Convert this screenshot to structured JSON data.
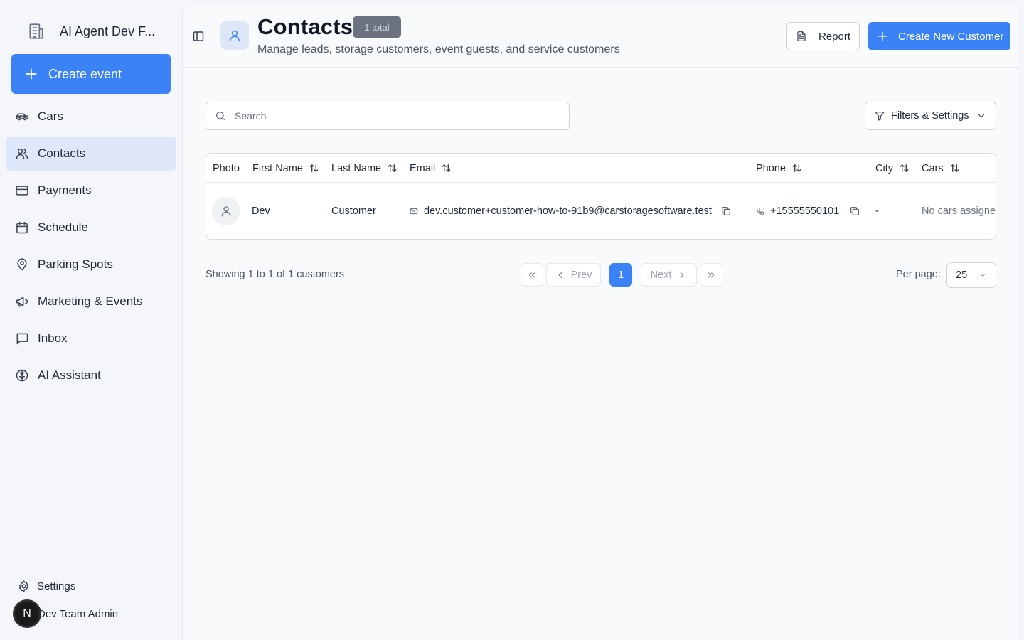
{
  "sidebar": {
    "org_name": "AI Agent Dev F...",
    "create_event_label": "Create event",
    "items": [
      {
        "label": "Cars",
        "icon": "car-icon"
      },
      {
        "label": "Contacts",
        "icon": "users-icon",
        "active": true
      },
      {
        "label": "Payments",
        "icon": "credit-card-icon"
      },
      {
        "label": "Schedule",
        "icon": "calendar-icon"
      },
      {
        "label": "Parking Spots",
        "icon": "map-pin-icon"
      },
      {
        "label": "Marketing & Events",
        "icon": "megaphone-icon"
      },
      {
        "label": "Inbox",
        "icon": "message-square-icon"
      },
      {
        "label": "AI Assistant",
        "icon": "brain-icon"
      }
    ],
    "settings_label": "Settings",
    "user_initial": "N",
    "user_name": "Dev Team Admin"
  },
  "header": {
    "title": "Contacts",
    "total_badge": "1 total",
    "subtitle": "Manage leads, storage customers, event guests, and service customers",
    "report_label": "Report",
    "create_label": "Create New Customer"
  },
  "search": {
    "placeholder": "Search",
    "value": ""
  },
  "filters_label": "Filters & Settings",
  "table": {
    "columns": [
      "Photo",
      "First Name",
      "Last Name",
      "Email",
      "Phone",
      "City",
      "Cars"
    ],
    "rows": [
      {
        "first_name": "Dev",
        "last_name": "Customer",
        "email": "dev.customer+customer-how-to-91b9@carstoragesoftware.test",
        "phone": "+15555550101",
        "city": "-",
        "cars": "No cars assigned"
      }
    ]
  },
  "pagination": {
    "summary": "Showing 1 to 1 of 1 customers",
    "prev_label": "Prev",
    "next_label": "Next",
    "current_page": "1",
    "per_page_label": "Per page:",
    "per_page_value": "25"
  },
  "colors": {
    "accent": "#3b82f6",
    "active_nav": "#dfe8fb",
    "badge": "#6b7280"
  }
}
